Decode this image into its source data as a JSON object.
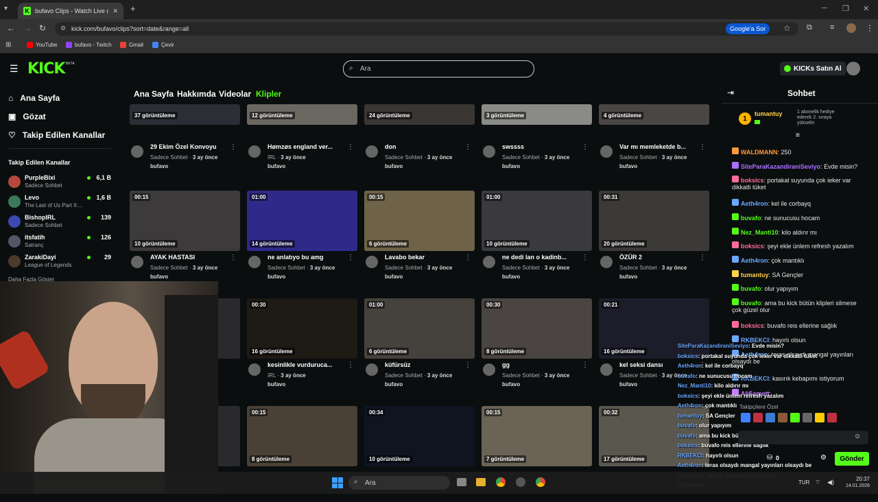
{
  "browser": {
    "tab_title": "bufavo Clips - Watch Live on Ki",
    "url": "kick.com/bufavo/clips?sort=date&range=all",
    "google_btn": "Google'a Sor",
    "bookmarks": [
      {
        "label": "YouTube",
        "color": "#ff0000"
      },
      {
        "label": "bufavo - Twitch",
        "color": "#9146ff"
      },
      {
        "label": "Gmail",
        "color": "#ea4335"
      },
      {
        "label": "Çevir",
        "color": "#4285f4"
      }
    ]
  },
  "header": {
    "logo": "KICK",
    "beta": "BETA",
    "search_placeholder": "Ara",
    "kicks_btn": "KICKs Satın Al"
  },
  "sidebar": {
    "nav": [
      {
        "label": "Ana Sayfa",
        "icon": "home-icon"
      },
      {
        "label": "Gözat",
        "icon": "browse-icon"
      },
      {
        "label": "Takip Edilen Kanallar",
        "icon": "heart-icon"
      }
    ],
    "section_title": "Takip Edilen Kanallar",
    "channels": [
      {
        "name": "PurpleBixi",
        "game": "Sadece Sohbet",
        "viewers": "6,1 B",
        "color": "#b5483b"
      },
      {
        "name": "Levo",
        "game": "The Last of Us Part II:...",
        "viewers": "1,6 B",
        "color": "#3a7a5a"
      },
      {
        "name": "BishopIRL",
        "game": "Sadece Sohbet",
        "viewers": "139",
        "color": "#3a4ab0"
      },
      {
        "name": "itsfatih",
        "game": "Satranç",
        "viewers": "126",
        "color": "#556"
      },
      {
        "name": "ZarakiDayi",
        "game": "League of Legends",
        "viewers": "29",
        "color": "#4a3a2a"
      }
    ],
    "more": "Daha Fazla Göster"
  },
  "tabs": [
    "Ana Sayfa",
    "Hakkımda",
    "Videolar",
    "Klipler"
  ],
  "clips": [
    {
      "duration": "",
      "views": "37 görüntüleme",
      "title": "29 Ekim Özel Konvoyu",
      "category": "Sadece Sohbet",
      "age": "3 ay önce",
      "user": "bufavo",
      "bg": "#2b2f35"
    },
    {
      "duration": "",
      "views": "12 görüntüleme",
      "title": "Hømzøs england ver...",
      "category": "IRL",
      "age": "3 ay önce",
      "user": "bufavo",
      "bg": "#6a6760"
    },
    {
      "duration": "",
      "views": "24 görüntüleme",
      "title": "don",
      "category": "Sadece Sohbet",
      "age": "3 ay önce",
      "user": "bufavo",
      "bg": "#3a3634"
    },
    {
      "duration": "",
      "views": "3 görüntüleme",
      "title": "swssss",
      "category": "Sadece Sohbet",
      "age": "3 ay önce",
      "user": "bufavo",
      "bg": "#8a8a86"
    },
    {
      "duration": "",
      "views": "4 görüntüleme",
      "title": "Var mı memleketde b...",
      "category": "Sadece Sohbet",
      "age": "3 ay önce",
      "user": "bufavo",
      "bg": "#4a4644"
    },
    {
      "duration": "00:15",
      "views": "10 görüntüleme",
      "title": "AYAK HASTASI",
      "category": "Sadece Sohbet",
      "age": "3 ay önce",
      "user": "bufavo",
      "bg": "#3d3a3c"
    },
    {
      "duration": "01:00",
      "views": "14 görüntüleme",
      "title": "ne anlatıyo bu amg",
      "category": "Sadece Sohbet",
      "age": "3 ay önce",
      "user": "bufavo",
      "bg": "#2f2a8a"
    },
    {
      "duration": "00:15",
      "views": "6 görüntüleme",
      "title": "Lavabo bekar",
      "category": "Sadece Sohbet",
      "age": "3 ay önce",
      "user": "bufavo",
      "bg": "#6e6248"
    },
    {
      "duration": "01:00",
      "views": "10 görüntüleme",
      "title": "ne dedi lan o kadinb...",
      "category": "Sadece Sohbet",
      "age": "3 ay önce",
      "user": "bufavo",
      "bg": "#3a3a3e"
    },
    {
      "duration": "00:31",
      "views": "20 görüntüleme",
      "title": "ÖZÜR 2",
      "category": "Sadece Sohbet",
      "age": "3 ay önce",
      "user": "bufavo",
      "bg": "#3c3a38"
    },
    {
      "duration": "",
      "views": "",
      "title": "",
      "category": "",
      "age": "",
      "user": "",
      "bg": "#2a2a2e"
    },
    {
      "duration": "00:30",
      "views": "16 görüntüleme",
      "title": "kesinlikle vurduruca...",
      "category": "IRL",
      "age": "3 ay önce",
      "user": "bufavo",
      "bg": "#1e1a14"
    },
    {
      "duration": "01:00",
      "views": "6 görüntüleme",
      "title": "küfürsüz",
      "category": "Sadece Sohbet",
      "age": "3 ay önce",
      "user": "bufavo",
      "bg": "#45423e"
    },
    {
      "duration": "00:30",
      "views": "8 görüntüleme",
      "title": "gg",
      "category": "Sadece Sohbet",
      "age": "3 ay önce",
      "user": "bufavo",
      "bg": "#4a4542"
    },
    {
      "duration": "00:21",
      "views": "16 görüntüleme",
      "title": "kel seksi dansı",
      "category": "Sadece Sohbet",
      "age": "3 ay önce",
      "user": "bufavo",
      "bg": "#1c1c2a"
    },
    {
      "duration": "",
      "views": "",
      "title": "",
      "category": "",
      "age": "",
      "user": "",
      "bg": "#2a2a2e"
    },
    {
      "duration": "00:15",
      "views": "8 görüntüleme",
      "title": "",
      "category": "",
      "age": "",
      "user": "",
      "bg": "#4a4036"
    },
    {
      "duration": "00:34",
      "views": "10 görüntüleme",
      "title": "",
      "category": "",
      "age": "",
      "user": "",
      "bg": "#0e1420"
    },
    {
      "duration": "00:15",
      "views": "7 görüntüleme",
      "title": "",
      "category": "",
      "age": "",
      "user": "",
      "bg": "#6a6356"
    },
    {
      "duration": "00:32",
      "views": "17 görüntüleme",
      "title": "",
      "category": "",
      "age": "",
      "user": "",
      "bg": "#5a574f"
    }
  ],
  "chat": {
    "title": "Sohbet",
    "pinned_user": "tumantuy",
    "pinned_rank": "1",
    "pinned_text": "1 abonelik hediye ederek 2. sıraya yükselin",
    "messages": [
      {
        "user": "WALDMANN",
        "text": ": 250",
        "color": "#ff9a3c"
      },
      {
        "user": "SiteParaKazandiraniSeviyo",
        "text": ": Evde misin?",
        "color": "#a970ff"
      },
      {
        "user": "boksics",
        "text": ": portakal suyunda çok ieker var dikkatli tüket",
        "color": "#ff6b9a"
      },
      {
        "user": "Aeth4ron",
        "text": ": kel ile corbayq",
        "color": "#6aa7ff"
      },
      {
        "user": "buvafo",
        "text": ": ne sunucusu hocam",
        "color": "#53fc18"
      },
      {
        "user": "Nez_Manti10",
        "text": ": kilo aldırır mı",
        "color": "#53fc18"
      },
      {
        "user": "boksics",
        "text": ": şeyi ekle ünlem refresh yazalım",
        "color": "#ff6b9a"
      },
      {
        "user": "Aeth4ron",
        "text": ": çok mantıklı",
        "color": "#6aa7ff"
      },
      {
        "user": "tumantuy",
        "text": ": SA Gençler",
        "color": "#ffd24a"
      },
      {
        "user": "buvafo",
        "text": ": olur yapıyım",
        "color": "#53fc18"
      },
      {
        "user": "buvafo",
        "text": ": ama bu kick bütün klipleri silmese çok güzel olur",
        "color": "#53fc18"
      },
      {
        "user": "boksics",
        "text": ": buvafo reis ellerine sağlık",
        "color": "#ff6b9a"
      },
      {
        "user": "RKBEKCI",
        "text": ": hayırlı olsun",
        "color": "#6aa7ff"
      },
      {
        "user": "Aeth4ron",
        "text": ": teras olsaydı mangal yayınları olsaydı be",
        "color": "#6aa7ff"
      },
      {
        "user": "RKBEKCI",
        "text": ": kasırık kebapımı istiyorum",
        "color": "#6aa7ff"
      },
      {
        "user": "AliSamett",
        "text": ":",
        "color": "#c77dff"
      }
    ],
    "subs_label": "Takipçilere Özel",
    "points": "0",
    "send_btn": "Gönder"
  },
  "overlay_chat": [
    {
      "user": "SiteParaKazandiraniSeviyo",
      "text": ": Evde misin?"
    },
    {
      "user": "boksics",
      "text": ": portakal suyunda çok ieker var dikkatli tüket"
    },
    {
      "user": "Aeth4ron",
      "text": ": kel ile corbayq"
    },
    {
      "user": "buvafo",
      "text": ": ne sunucusu hocam"
    },
    {
      "user": "Nez_Manti10",
      "text": ": kilo aldırır mı"
    },
    {
      "user": "boksics",
      "text": ": şeyi ekle ünlem refresh yazalım"
    },
    {
      "user": "Aeth4ron",
      "text": ": çok mantıklı"
    },
    {
      "user": "tumantuy",
      "text": ": SA Gençler"
    },
    {
      "user": "buvafo",
      "text": ": olur yapıyım"
    },
    {
      "user": "buvafo",
      "text": ": ama bu kick bütün klipleri silmese çok güzel olur"
    },
    {
      "user": "boksics",
      "text": ": buvafo reis ellerine sağlık"
    },
    {
      "user": "RKBEKCI",
      "text": ": hayırlı olsun"
    },
    {
      "user": "Aeth4ron",
      "text": ": teras olsaydı mangal yayınları olsaydı be"
    },
    {
      "user": "RKBEKCI",
      "text": ": kasırık kebapımı istiyorum"
    },
    {
      "user": "AliSamett",
      "text": ":"
    }
  ],
  "taskbar": {
    "search": "Ara",
    "lang": "TUR",
    "time": "20:37",
    "date": "14.01.2026"
  }
}
